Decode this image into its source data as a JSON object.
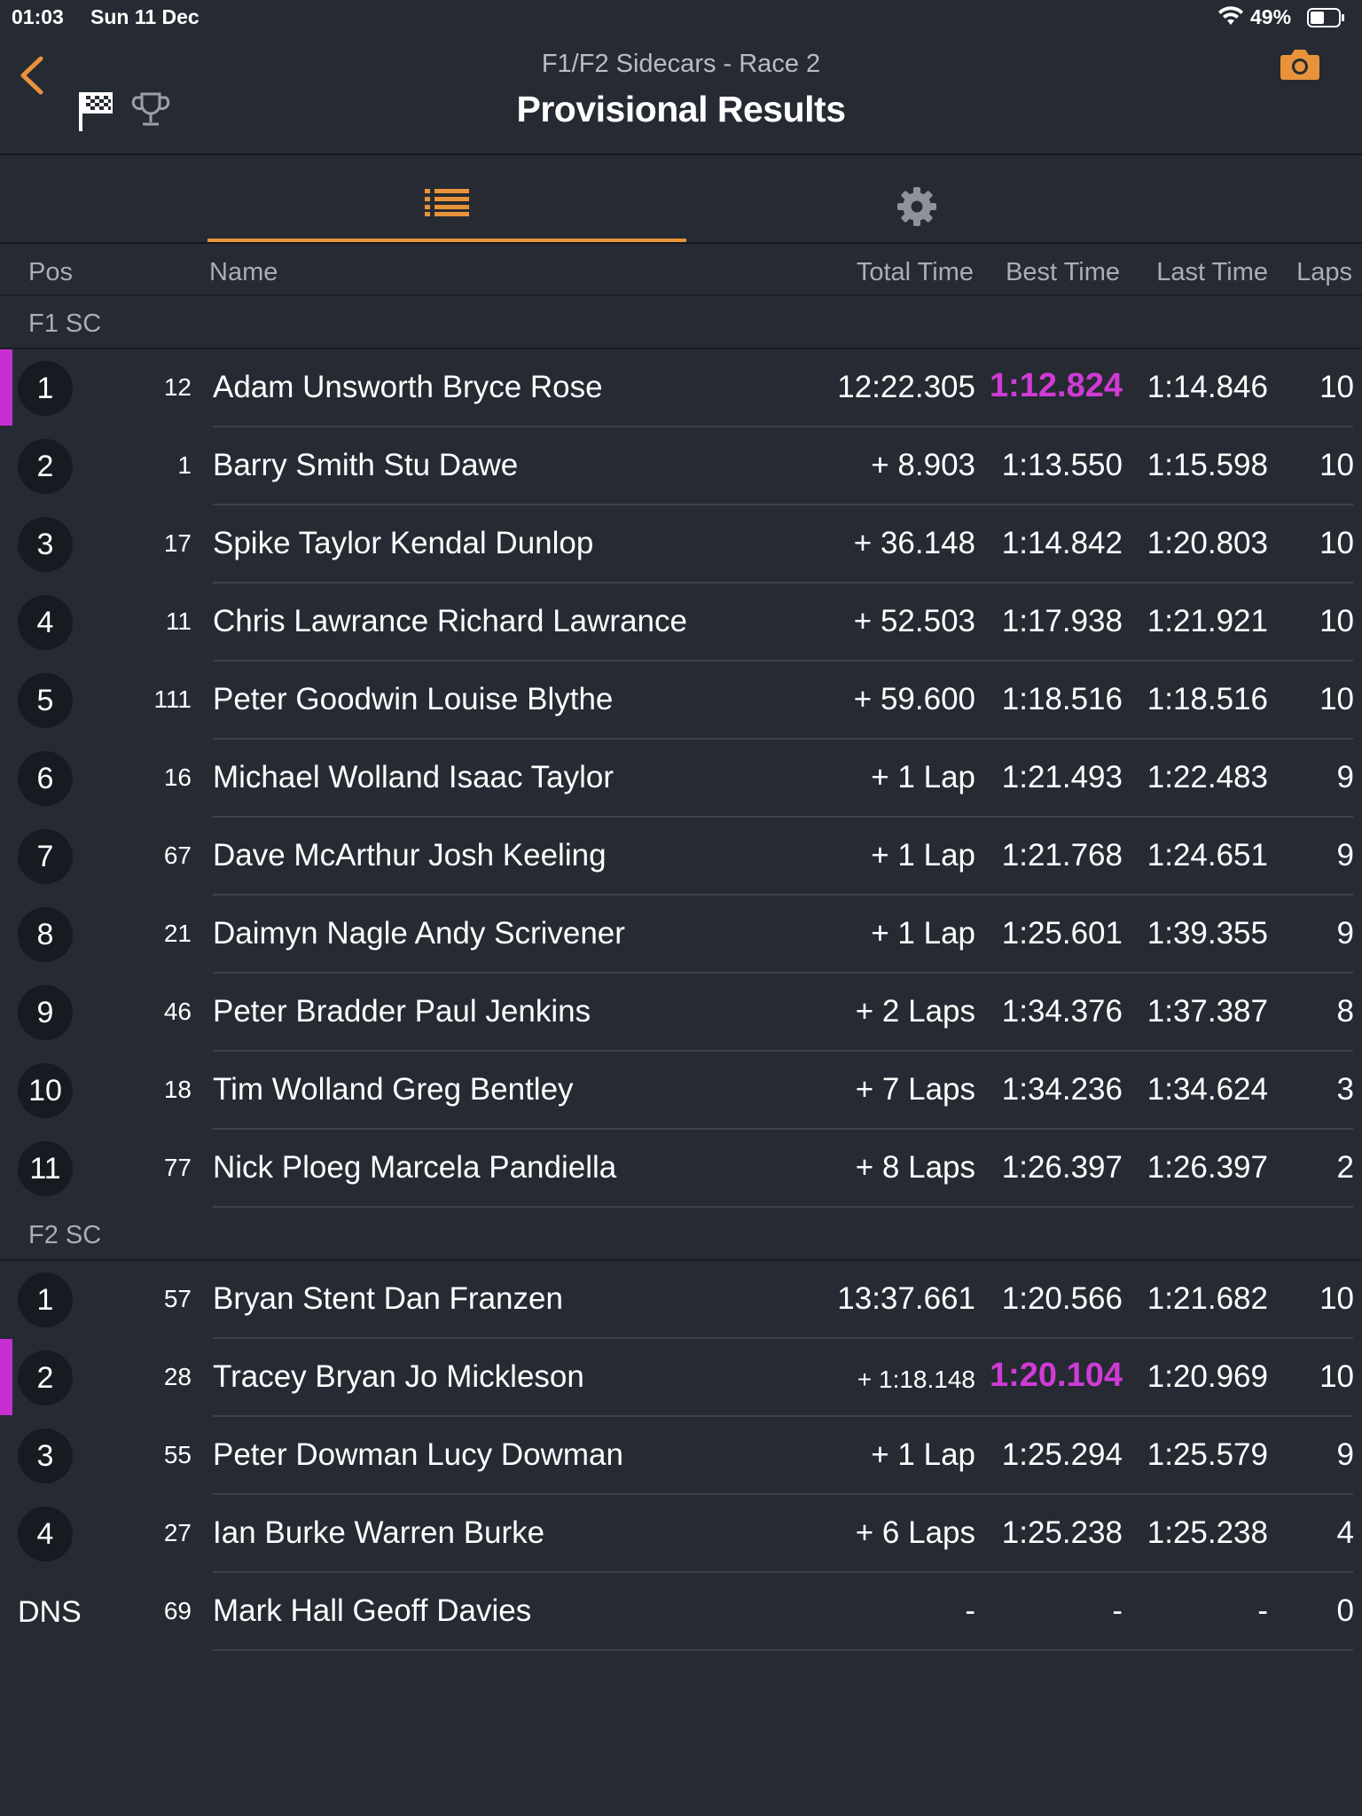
{
  "status": {
    "time": "01:03",
    "date": "Sun 11 Dec",
    "battery": "49%"
  },
  "nav": {
    "subtitle": "F1/F2 Sidecars - Race 2",
    "title": "Provisional Results"
  },
  "colors": {
    "accent": "#e8933a",
    "fastest": "#d03bd6",
    "background": "#262a33"
  },
  "columns": {
    "pos": "Pos",
    "name": "Name",
    "total": "Total Time",
    "best": "Best Time",
    "last": "Last Time",
    "laps": "Laps"
  },
  "groups": [
    {
      "label": "F1 SC",
      "rows": [
        {
          "pos": "1",
          "num": "12",
          "name": "Adam Unsworth Bryce Rose",
          "total": "12:22.305",
          "best": "1:12.824",
          "last": "1:14.846",
          "laps": "10",
          "fastest": true
        },
        {
          "pos": "2",
          "num": "1",
          "name": "Barry Smith Stu Dawe",
          "total": "+ 8.903",
          "best": "1:13.550",
          "last": "1:15.598",
          "laps": "10"
        },
        {
          "pos": "3",
          "num": "17",
          "name": "Spike Taylor Kendal Dunlop",
          "total": "+ 36.148",
          "best": "1:14.842",
          "last": "1:20.803",
          "laps": "10"
        },
        {
          "pos": "4",
          "num": "11",
          "name": "Chris Lawrance Richard Lawrance",
          "total": "+ 52.503",
          "best": "1:17.938",
          "last": "1:21.921",
          "laps": "10"
        },
        {
          "pos": "5",
          "num": "111",
          "name": "Peter Goodwin Louise Blythe",
          "total": "+ 59.600",
          "best": "1:18.516",
          "last": "1:18.516",
          "laps": "10"
        },
        {
          "pos": "6",
          "num": "16",
          "name": "Michael Wolland Isaac Taylor",
          "total": "+ 1 Lap",
          "best": "1:21.493",
          "last": "1:22.483",
          "laps": "9"
        },
        {
          "pos": "7",
          "num": "67",
          "name": "Dave McArthur Josh Keeling",
          "total": "+ 1 Lap",
          "best": "1:21.768",
          "last": "1:24.651",
          "laps": "9"
        },
        {
          "pos": "8",
          "num": "21",
          "name": "Daimyn Nagle Andy Scrivener",
          "total": "+ 1 Lap",
          "best": "1:25.601",
          "last": "1:39.355",
          "laps": "9"
        },
        {
          "pos": "9",
          "num": "46",
          "name": "Peter Bradder Paul Jenkins",
          "total": "+ 2 Laps",
          "best": "1:34.376",
          "last": "1:37.387",
          "laps": "8"
        },
        {
          "pos": "10",
          "num": "18",
          "name": "Tim Wolland Greg Bentley",
          "total": "+ 7 Laps",
          "best": "1:34.236",
          "last": "1:34.624",
          "laps": "3"
        },
        {
          "pos": "11",
          "num": "77",
          "name": "Nick Ploeg Marcela Pandiella",
          "total": "+ 8 Laps",
          "best": "1:26.397",
          "last": "1:26.397",
          "laps": "2"
        }
      ]
    },
    {
      "label": "F2 SC",
      "rows": [
        {
          "pos": "1",
          "num": "57",
          "name": "Bryan Stent Dan Franzen",
          "total": "13:37.661",
          "best": "1:20.566",
          "last": "1:21.682",
          "laps": "10"
        },
        {
          "pos": "2",
          "num": "28",
          "name": "Tracey Bryan Jo Mickleson",
          "total": "+ 1:18.148",
          "best": "1:20.104",
          "last": "1:20.969",
          "laps": "10",
          "fastest": true,
          "small_total": true
        },
        {
          "pos": "3",
          "num": "55",
          "name": "Peter Dowman Lucy Dowman",
          "total": "+ 1 Lap",
          "best": "1:25.294",
          "last": "1:25.579",
          "laps": "9"
        },
        {
          "pos": "4",
          "num": "27",
          "name": "Ian Burke Warren Burke",
          "total": "+ 6 Laps",
          "best": "1:25.238",
          "last": "1:25.238",
          "laps": "4"
        },
        {
          "pos": "DNS",
          "num": "69",
          "name": "Mark Hall Geoff Davies",
          "total": "-",
          "best": "-",
          "last": "-",
          "laps": "0"
        }
      ]
    }
  ]
}
